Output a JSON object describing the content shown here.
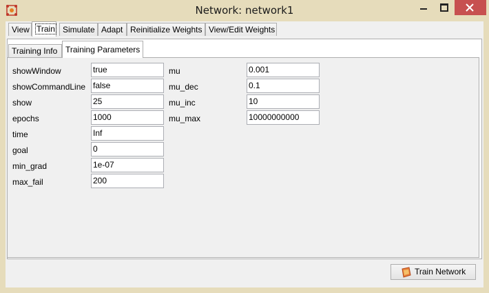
{
  "window": {
    "title": "Network: network1",
    "icon": "network-app-icon"
  },
  "tabs": [
    {
      "label": "View",
      "active": false
    },
    {
      "label": "Train",
      "active": true
    },
    {
      "label": "Simulate",
      "active": false
    },
    {
      "label": "Adapt",
      "active": false
    },
    {
      "label": "Reinitialize Weights",
      "active": false
    },
    {
      "label": "View/Edit Weights",
      "active": false
    }
  ],
  "subtabs": [
    {
      "label": "Training Info",
      "active": false
    },
    {
      "label": "Training Parameters",
      "active": true
    }
  ],
  "params_left": [
    {
      "name": "showWindow",
      "value": "true"
    },
    {
      "name": "showCommandLine",
      "value": "false"
    },
    {
      "name": "show",
      "value": "25"
    },
    {
      "name": "epochs",
      "value": "1000"
    },
    {
      "name": "time",
      "value": "Inf"
    },
    {
      "name": "goal",
      "value": "0"
    },
    {
      "name": "min_grad",
      "value": "1e-07"
    },
    {
      "name": "max_fail",
      "value": "200"
    }
  ],
  "params_right": [
    {
      "name": "mu",
      "value": "0.001"
    },
    {
      "name": "mu_dec",
      "value": "0.1"
    },
    {
      "name": "mu_inc",
      "value": "10"
    },
    {
      "name": "mu_max",
      "value": "10000000000"
    }
  ],
  "train_button": {
    "label": "Train Network",
    "icon": "train-network-icon"
  },
  "colors": {
    "frame": "#e6dcbb",
    "close": "#c75050"
  }
}
